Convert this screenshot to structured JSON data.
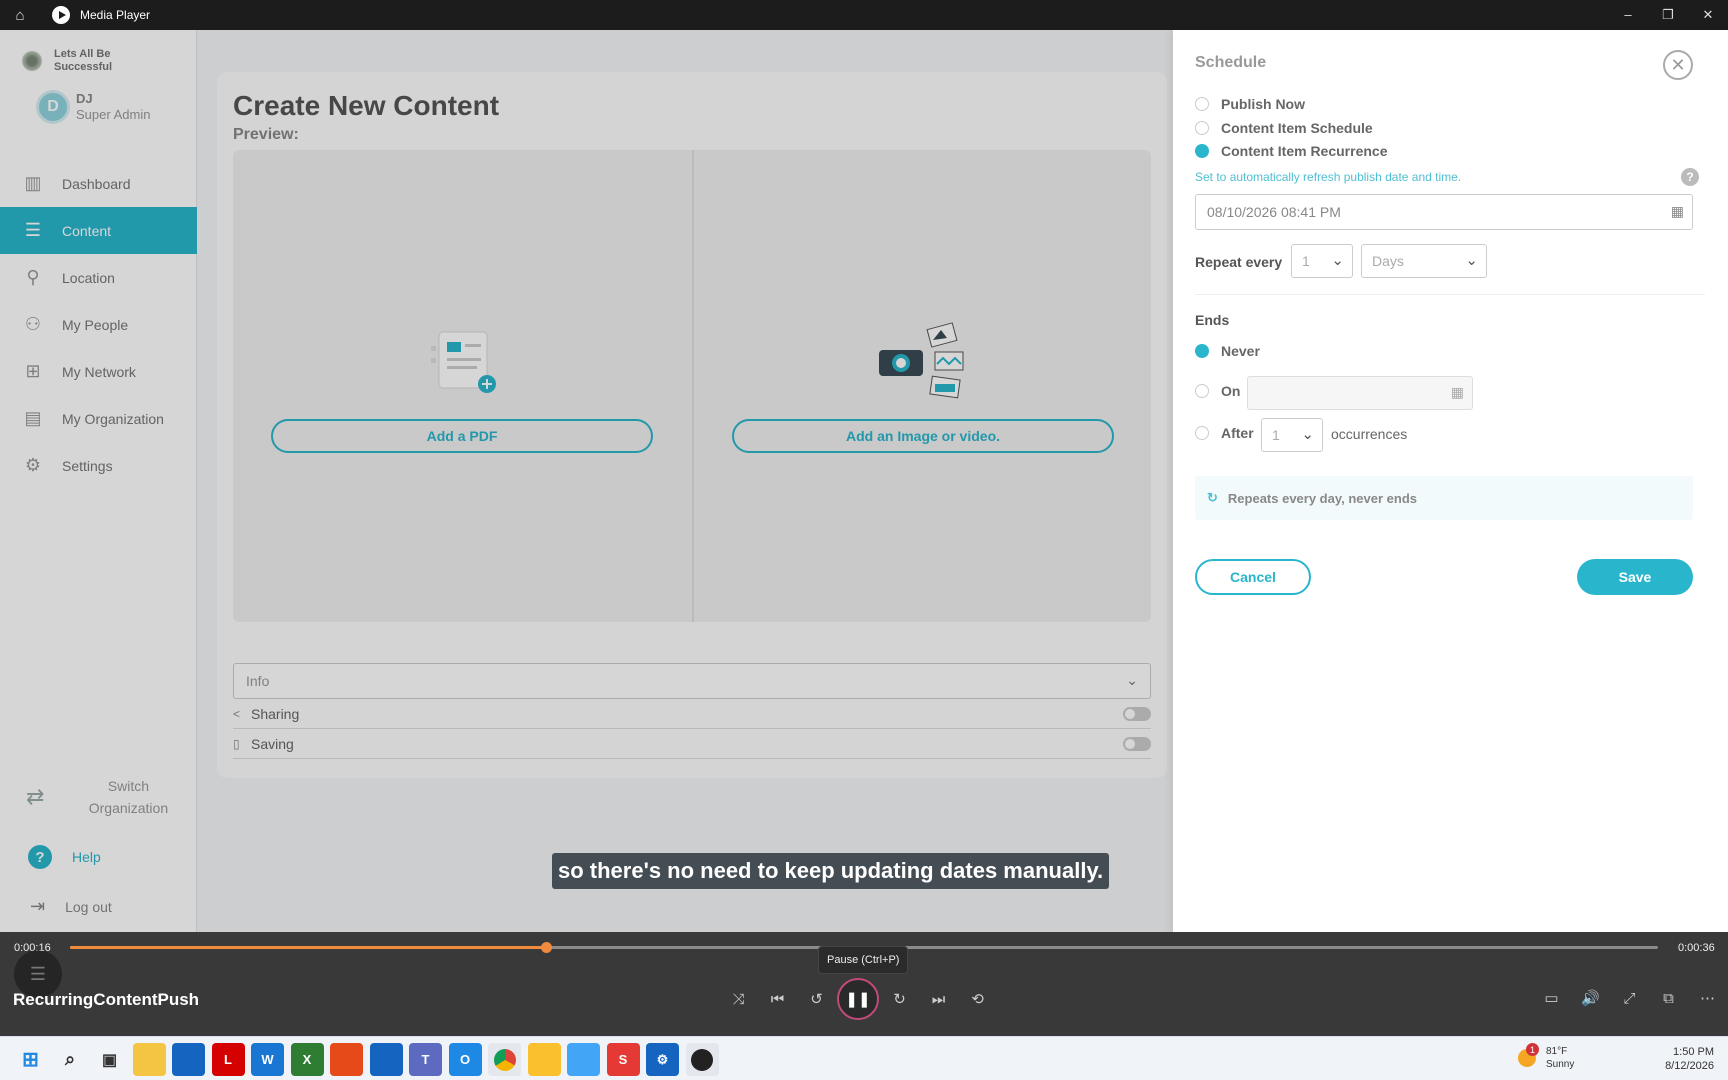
{
  "window": {
    "title": "Media Player",
    "controls": [
      "–",
      "❐",
      "✕"
    ]
  },
  "sidebar": {
    "org_name": "Lets All Be Successful",
    "user": {
      "initial": "D",
      "name": "DJ",
      "role": "Super Admin"
    },
    "items": [
      {
        "label": "Dashboard",
        "icon": "bar-chart-icon",
        "active": false
      },
      {
        "label": "Content",
        "icon": "content-icon",
        "active": true
      },
      {
        "label": "Location",
        "icon": "location-pin-icon",
        "active": false
      },
      {
        "label": "My People",
        "icon": "people-icon",
        "active": false
      },
      {
        "label": "My Network",
        "icon": "network-icon",
        "active": false
      },
      {
        "label": "My Organization",
        "icon": "organization-icon",
        "active": false
      },
      {
        "label": "Settings",
        "icon": "gear-icon",
        "active": false
      }
    ],
    "switch_org": "Switch Organization",
    "help": "Help",
    "logout": "Log out"
  },
  "main": {
    "title": "Create New Content",
    "preview_label": "Preview:",
    "add_pdf": "Add a PDF",
    "add_media": "Add an Image or video.",
    "info_select": "Info",
    "sharing": "Sharing",
    "saving": "Saving"
  },
  "schedule": {
    "title": "Schedule",
    "options": [
      {
        "label": "Publish Now",
        "selected": false
      },
      {
        "label": "Content Item Schedule",
        "selected": false
      },
      {
        "label": "Content Item Recurrence",
        "selected": true
      }
    ],
    "refresh_note": "Set to automatically refresh publish date and time.",
    "date_value": "08/10/2026 08:41 PM",
    "repeat_label": "Repeat every",
    "repeat_num": "1",
    "repeat_unit": "Days",
    "ends_label": "Ends",
    "ends_never": "Never",
    "ends_on": "On",
    "ends_after": "After",
    "after_num": "1",
    "occurrences": "occurrences",
    "summary": "Repeats every day, never ends",
    "cancel": "Cancel",
    "save": "Save"
  },
  "caption": "so there's no need to keep updating dates manually.",
  "player": {
    "time_current": "0:00:16",
    "time_total": "0:00:36",
    "progress": 0.3,
    "tooltip": "Pause (Ctrl+P)",
    "media_title": "RecurringContentPush",
    "accent_color": "#f08a3c"
  },
  "taskbar": {
    "weather_temp": "81°F",
    "weather_desc": "Sunny",
    "weather_badge": "1",
    "time": "1:50 PM",
    "date": "8/12/2026"
  },
  "colors": {
    "brand": "#29b6cc"
  }
}
